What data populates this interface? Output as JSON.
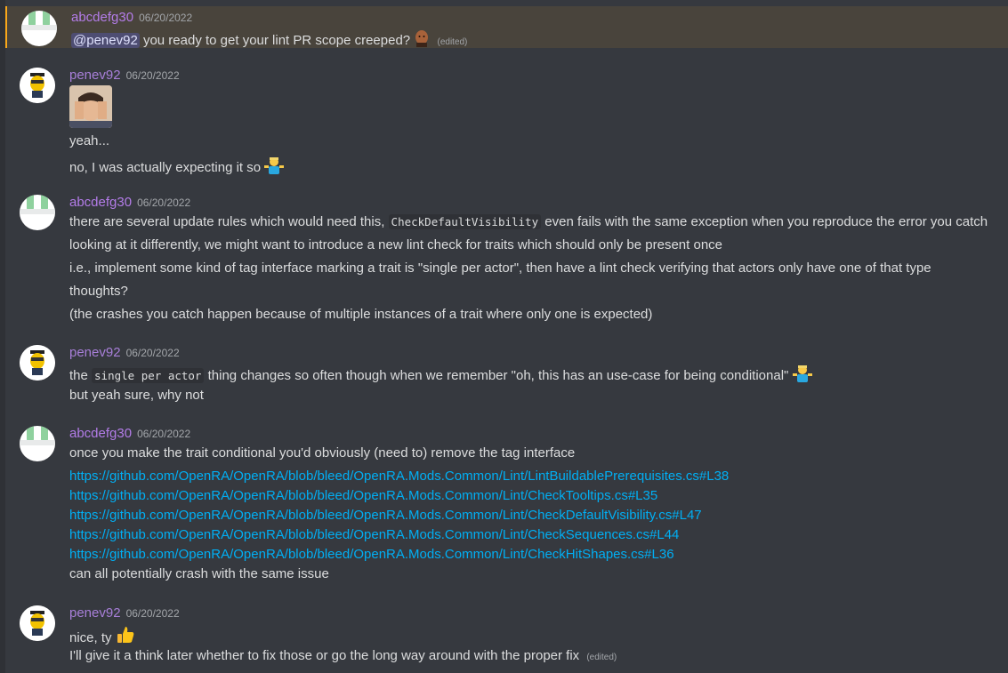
{
  "colors": {
    "background": "#36393f",
    "highlight_bg": "#49443c",
    "highlight_border": "#faa81a",
    "link": "#00aff4",
    "username_abc": "#b37ce8",
    "username_pen": "#a87fd9"
  },
  "messages": [
    {
      "user": "abcdefg30",
      "date": "06/20/2022",
      "mention": "@penev92",
      "text": "you ready to get your lint PR scope creeped?",
      "emoji": "bald-man-face-icon",
      "edited": "(edited)"
    },
    {
      "user": "penev92",
      "date": "06/20/2022",
      "attachment": "facepalm-gif",
      "lines": [
        "yeah...",
        "no, I was actually expecting it so"
      ],
      "emoji": "shrug-icon"
    },
    {
      "user": "abcdefg30",
      "date": "06/20/2022",
      "line1_a": "there are several update rules which would need this,",
      "line1_code": "CheckDefaultVisibility",
      "line1_b": "even fails with the same exception when you reproduce the error you catch",
      "line2": "looking at it differently, we might want to introduce a new lint check for traits which should only be present once",
      "line3": "i.e., implement some kind of tag interface marking a trait is \"single per actor\", then have a lint check verifying that actors only have one of that type",
      "line4": "thoughts?",
      "line5": "(the crashes you catch happen because of multiple instances of a trait where only one is expected)"
    },
    {
      "user": "penev92",
      "date": "06/20/2022",
      "line1_a": "the",
      "line1_code": "single per actor",
      "line1_b": "thing changes so often though when we remember \"oh, this has an use-case for being conditional\"",
      "line2": "but yeah sure, why not",
      "emoji": "shrug-icon"
    },
    {
      "user": "abcdefg30",
      "date": "06/20/2022",
      "line1": "once you make the trait conditional you'd obviously (need to) remove the tag interface",
      "links": [
        "https://github.com/OpenRA/OpenRA/blob/bleed/OpenRA.Mods.Common/Lint/LintBuildablePrerequisites.cs#L38",
        "https://github.com/OpenRA/OpenRA/blob/bleed/OpenRA.Mods.Common/Lint/CheckTooltips.cs#L35",
        "https://github.com/OpenRA/OpenRA/blob/bleed/OpenRA.Mods.Common/Lint/CheckDefaultVisibility.cs#L47",
        "https://github.com/OpenRA/OpenRA/blob/bleed/OpenRA.Mods.Common/Lint/CheckSequences.cs#L44",
        "https://github.com/OpenRA/OpenRA/blob/bleed/OpenRA.Mods.Common/Lint/CheckHitShapes.cs#L36"
      ],
      "last": "can all potentially crash with the same issue"
    },
    {
      "user": "penev92",
      "date": "06/20/2022",
      "line1": "nice, ty",
      "emoji": "thumbs-up-icon",
      "line2": "I'll give it a think later whether to fix those or go the long way around with the proper fix",
      "edited": "(edited)"
    }
  ]
}
